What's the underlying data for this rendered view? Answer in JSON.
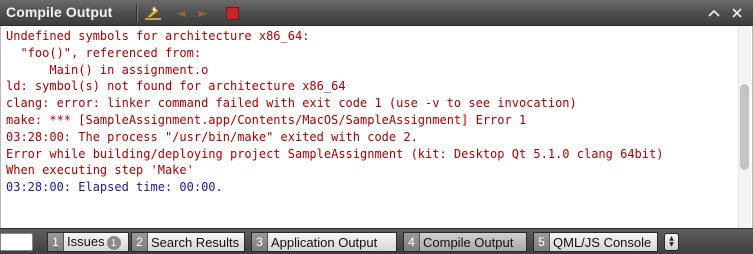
{
  "title_bar": {
    "title": "Compile Output",
    "icons": [
      "clean-icon",
      "arrow-left-icon",
      "arrow-right-icon",
      "stop-icon",
      "maximize-icon",
      "close-icon"
    ]
  },
  "output": {
    "lines": [
      {
        "text": "Undefined symbols for architecture x86_64:",
        "color": "#b30000"
      },
      {
        "text": "  \"foo()\", referenced from:",
        "color": "#b30000"
      },
      {
        "text": "      Main() in assignment.o",
        "color": "#b30000"
      },
      {
        "text": "ld: symbol(s) not found for architecture x86_64",
        "color": "#b30000"
      },
      {
        "text": "clang: error: linker command failed with exit code 1 (use -v to see invocation)",
        "color": "#b30000"
      },
      {
        "text": "make: *** [SampleAssignment.app/Contents/MacOS/SampleAssignment] Error 1",
        "color": "#b30000"
      },
      {
        "text": "03:28:00: The process \"/usr/bin/make\" exited with code 2.",
        "color": "#b30000"
      },
      {
        "text": "Error while building/deploying project SampleAssignment (kit: Desktop Qt 5.1.0 clang 64bit)",
        "color": "#b30000"
      },
      {
        "text": "When executing step 'Make'",
        "color": "#b30000"
      },
      {
        "text": "03:28:00: Elapsed time: 00:00.",
        "color": "#1a1aa6"
      }
    ]
  },
  "bottom_bar": {
    "panes": [
      {
        "num": "1",
        "label": "Issues",
        "badge": "1"
      },
      {
        "num": "2",
        "label": "Search Results"
      },
      {
        "num": "3",
        "label": "Application Output"
      },
      {
        "num": "4",
        "label": "Compile Output",
        "active": true
      },
      {
        "num": "5",
        "label": "QML/JS Console"
      }
    ]
  }
}
